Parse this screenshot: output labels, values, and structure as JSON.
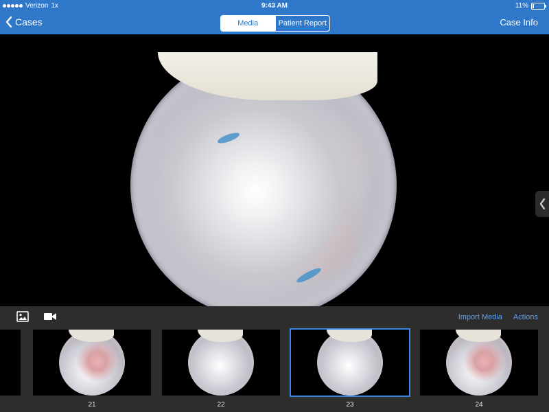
{
  "status": {
    "carrier": "Verizon",
    "speed": "1x",
    "time": "9:43 AM",
    "battery": "11%"
  },
  "nav": {
    "back_label": "Cases",
    "segments": [
      "Media",
      "Patient Report"
    ],
    "active_segment": "Media",
    "right_label": "Case Info"
  },
  "toolbar": {
    "import_label": "Import Media",
    "actions_label": "Actions",
    "icons": [
      "photo-icon",
      "video-camera-icon"
    ]
  },
  "thumbnails": [
    {
      "label": "21"
    },
    {
      "label": "22"
    },
    {
      "label": "23",
      "selected": true
    },
    {
      "label": "24"
    }
  ],
  "colors": {
    "nav_blue": "#2f78c9",
    "link_blue": "#5aa0ef",
    "selection_blue": "#3a86e5",
    "toolbar_gray": "#2d2d2d"
  },
  "side_handle_icon": "chevron-left-icon"
}
